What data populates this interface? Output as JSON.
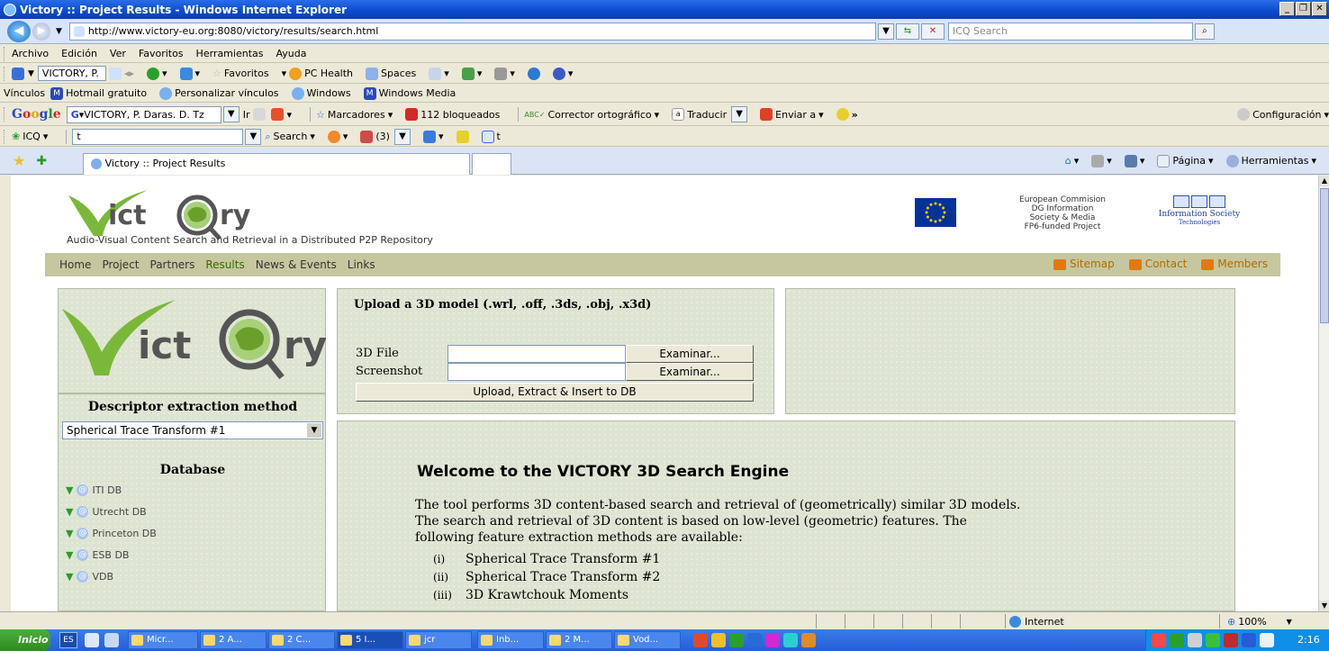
{
  "window": {
    "title": "Victory :: Project Results - Windows Internet Explorer"
  },
  "address": {
    "url": "http://www.victory-eu.org:8080/victory/results/search.html",
    "search_placeholder": "ICQ Search"
  },
  "menu": [
    "Archivo",
    "Edición",
    "Ver",
    "Favoritos",
    "Herramientas",
    "Ayuda"
  ],
  "toolbar1": {
    "search_value": "VICTORY, P.",
    "favoritos": "Favoritos",
    "pc_health": "PC Health",
    "spaces": "Spaces"
  },
  "links_bar": {
    "label": "Vínculos",
    "items": [
      "Hotmail gratuito",
      "Personalizar vínculos",
      "Windows",
      "Windows Media"
    ]
  },
  "google_bar": {
    "search_value": "VICTORY, P. Daras. D. Tz",
    "go": "Ir",
    "bookmarks": "Marcadores",
    "blocked": "112 bloqueados",
    "spell": "Corrector ortográfico",
    "translate": "Traducir",
    "send": "Enviar a",
    "more": "»",
    "settings": "Configuración"
  },
  "icq_bar": {
    "label": "ICQ",
    "input_value": "t",
    "search": "Search",
    "count": "(3)",
    "t_label": "t"
  },
  "tab": {
    "label": "Victory :: Project Results"
  },
  "command_bar": {
    "page": "Página",
    "tools": "Herramientas"
  },
  "site": {
    "logo_left": "ict",
    "logo_right": "ry",
    "tagline": "Audio-Visual Content Search and Retrieval in a Distributed P2P Repository",
    "eu_text": [
      "European Commision",
      "DG Information",
      "Society & Media",
      "FP6-funded Project"
    ],
    "ist_text": [
      "Information Society",
      "Technologies"
    ],
    "nav": [
      "Home",
      "Project",
      "Partners",
      "Results",
      "News & Events",
      "Links"
    ],
    "nav_active": "Results",
    "nav_right": [
      "Sitemap",
      "Contact",
      "Members"
    ],
    "descriptor_title": "Descriptor extraction method",
    "descriptor_selected": "Spherical Trace Transform #1",
    "database_title": "Database",
    "databases": [
      "ITI DB",
      "Utrecht DB",
      "Princeton DB",
      "ESB DB",
      "VDB"
    ],
    "upload_title": "Upload a 3D model (.wrl, .off, .3ds, .obj, .x3d)",
    "file_label": "3D File",
    "screenshot_label": "Screenshot",
    "browse": "Examinar...",
    "upload_button": "Upload, Extract & Insert to DB",
    "welcome_title": "Welcome to the VICTORY 3D Search Engine",
    "welcome_lines": [
      "The tool performs 3D content-based search and retrieval of (geometrically) similar 3D models.",
      "The search and retrieval of 3D content is based on low-level (geometric) features. The",
      "following feature extraction methods are available:"
    ],
    "methods": [
      {
        "num": "(i)",
        "name": "Spherical Trace Transform #1"
      },
      {
        "num": "(ii)",
        "name": "Spherical Trace Transform #2"
      },
      {
        "num": "(iii)",
        "name": "3D Krawtchouk Moments"
      }
    ]
  },
  "status": {
    "zone": "Internet",
    "zoom": "100%"
  },
  "taskbar": {
    "start": "Inicio",
    "lang": "ES",
    "tasks": [
      "Micr...",
      "2 A...",
      "2 C...",
      "5 I...",
      "jcr",
      "Inb...",
      "2 M...",
      "Vod..."
    ],
    "clock": "2:16"
  },
  "colors": {
    "accent": "#0a4bcf",
    "nav_bg": "#c6c79f",
    "panel_bg": "#dee4d2",
    "link_active": "#3b6b00"
  }
}
